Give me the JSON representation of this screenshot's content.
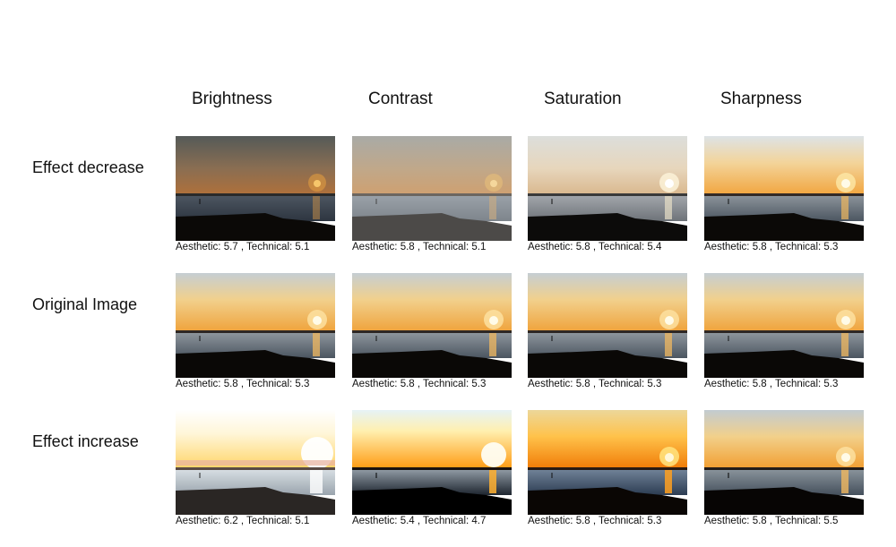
{
  "columns": [
    "Brightness",
    "Contrast",
    "Saturation",
    "Sharpness"
  ],
  "rows": [
    {
      "label": "Effect decrease",
      "captions": [
        "Aesthetic: 5.7 , Technical: 5.1",
        "Aesthetic: 5.8 , Technical: 5.1",
        "Aesthetic: 5.8 , Technical: 5.4",
        "Aesthetic: 5.8 , Technical: 5.3"
      ]
    },
    {
      "label": "Original Image",
      "captions": [
        "Aesthetic: 5.8 , Technical: 5.3",
        "Aesthetic: 5.8 , Technical: 5.3",
        "Aesthetic: 5.8 , Technical: 5.3",
        "Aesthetic: 5.8 , Technical: 5.3"
      ]
    },
    {
      "label": "Effect increase",
      "captions": [
        "Aesthetic: 6.2 , Technical: 5.1",
        "Aesthetic: 5.4 , Technical: 4.7",
        "Aesthetic: 5.8 , Technical: 5.3",
        "Aesthetic: 5.8 , Technical: 5.5"
      ]
    }
  ]
}
